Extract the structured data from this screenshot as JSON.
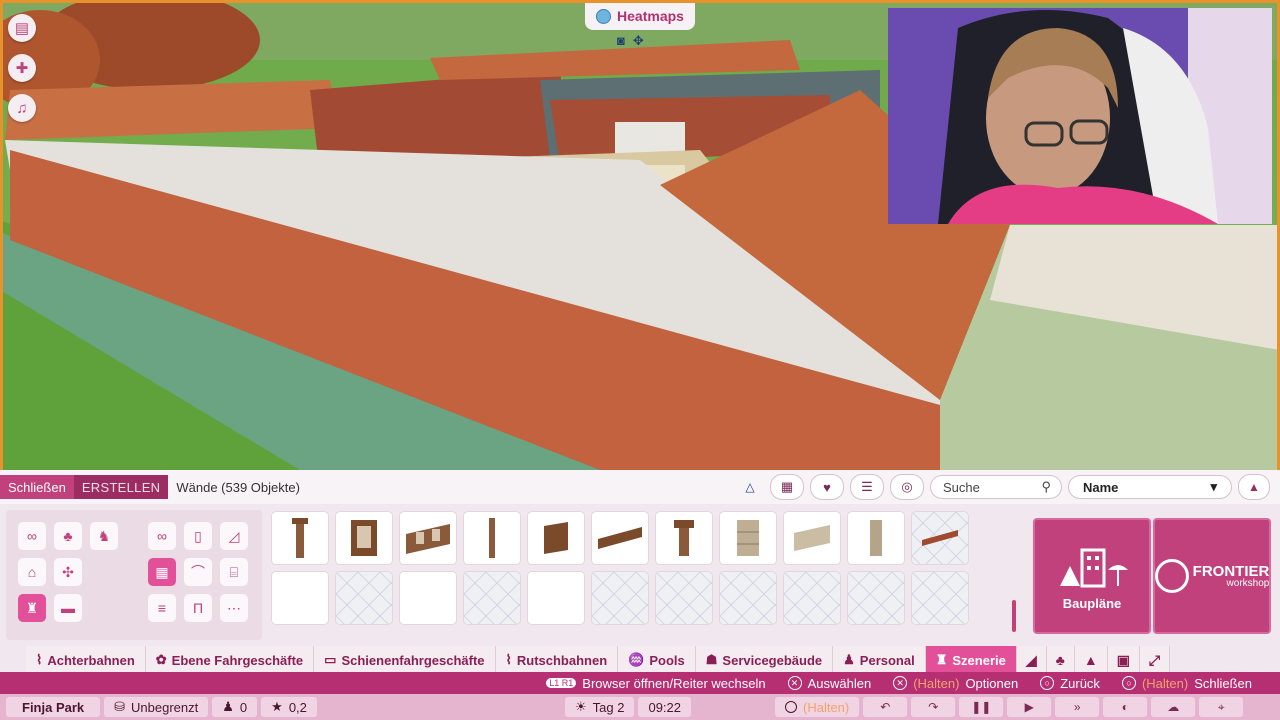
{
  "hud": {
    "heatmaps_label": "Heatmaps",
    "side_icons": [
      "clipboard-icon",
      "add-guest-icon",
      "bell-icon"
    ],
    "camera_icons": [
      "focus-icon",
      "move-icon"
    ]
  },
  "browser": {
    "close_label": "Schließen",
    "create_label": "ERSTELLEN",
    "title": "Wände (539 Objekte)",
    "search_placeholder": "Suche",
    "sort_value": "Name"
  },
  "tiles": {
    "blueprints_label": "Baupläne",
    "frontier_label": "FRONTIER",
    "frontier_sub": "workshop"
  },
  "tabs": [
    {
      "label": "Achterbahnen",
      "icon": "coaster-icon"
    },
    {
      "label": "Ebene Fahrgeschäfte",
      "icon": "flat-ride-icon"
    },
    {
      "label": "Schienenfahrgeschäfte",
      "icon": "track-ride-icon"
    },
    {
      "label": "Rutschbahnen",
      "icon": "slide-icon"
    },
    {
      "label": "Pools",
      "icon": "pool-icon"
    },
    {
      "label": "Servicegebäude",
      "icon": "service-icon"
    },
    {
      "label": "Personal",
      "icon": "staff-icon"
    },
    {
      "label": "Szenerie",
      "icon": "scenery-icon"
    }
  ],
  "hints": {
    "browser": "Browser öffnen/Reiter wechseln",
    "browser_keys": "L1 R1",
    "select": "Auswählen",
    "hold": "(Halten)",
    "options": "Optionen",
    "back": "Zurück",
    "close": "Schließen"
  },
  "status": {
    "park_name": "Finja Park",
    "money": "Unbegrenzt",
    "guests": "0",
    "rating": "0,2",
    "day": "Tag 2",
    "time": "09:22",
    "hold": "(Halten)"
  },
  "colors": {
    "accent": "#c0417c",
    "accent_dark": "#9c2d63",
    "active_tab": "#e2509a",
    "frame": "#e8922c"
  }
}
